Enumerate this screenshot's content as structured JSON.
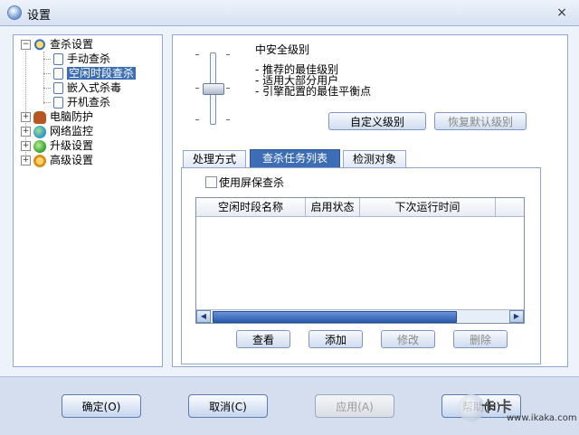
{
  "window": {
    "title": "设置",
    "close_glyph": "×"
  },
  "tree": {
    "items": [
      {
        "label": "查杀设置",
        "expander": "−",
        "icon": "magnifier-icon"
      },
      {
        "label": "手动查杀",
        "icon": "document-icon"
      },
      {
        "label": "空闲时段查杀",
        "icon": "document-icon",
        "selected": true
      },
      {
        "label": "嵌入式杀毒",
        "icon": "document-icon"
      },
      {
        "label": "开机查杀",
        "icon": "document-icon"
      },
      {
        "label": "电脑防护",
        "expander": "+",
        "icon": "glove-icon"
      },
      {
        "label": "网络监控",
        "expander": "+",
        "icon": "globe-icon"
      },
      {
        "label": "升级设置",
        "expander": "+",
        "icon": "update-icon"
      },
      {
        "label": "高级设置",
        "expander": "+",
        "icon": "gear-icon"
      }
    ]
  },
  "security_level": {
    "title": "中安全级别",
    "lines": [
      "- 推荐的最佳级别",
      "- 适用大部分用户",
      "- 引擎配置的最佳平衡点"
    ],
    "custom_button": "自定义级别",
    "restore_button": "恢复默认级别"
  },
  "tabs": [
    {
      "label": "处理方式"
    },
    {
      "label": "查杀任务列表",
      "active": true
    },
    {
      "label": "检测对象"
    }
  ],
  "task_tab": {
    "screensaver_checkbox": "使用屏保查杀",
    "columns": [
      "空闲时段名称",
      "启用状态",
      "下次运行时间"
    ],
    "rows": [],
    "buttons": {
      "view": "查看",
      "add": "添加",
      "modify": "修改",
      "delete": "删除"
    }
  },
  "bottom": {
    "ok": "确定(O)",
    "cancel": "取消(C)",
    "apply": "应用(A)",
    "help": "帮助(H)"
  },
  "watermark": {
    "logo": "卡卡",
    "url": "www.ikaka.com"
  },
  "colors": {
    "selection": "#3d6db4",
    "panel_border": "#8fa7cc",
    "window_bg": "#eef2fa"
  }
}
